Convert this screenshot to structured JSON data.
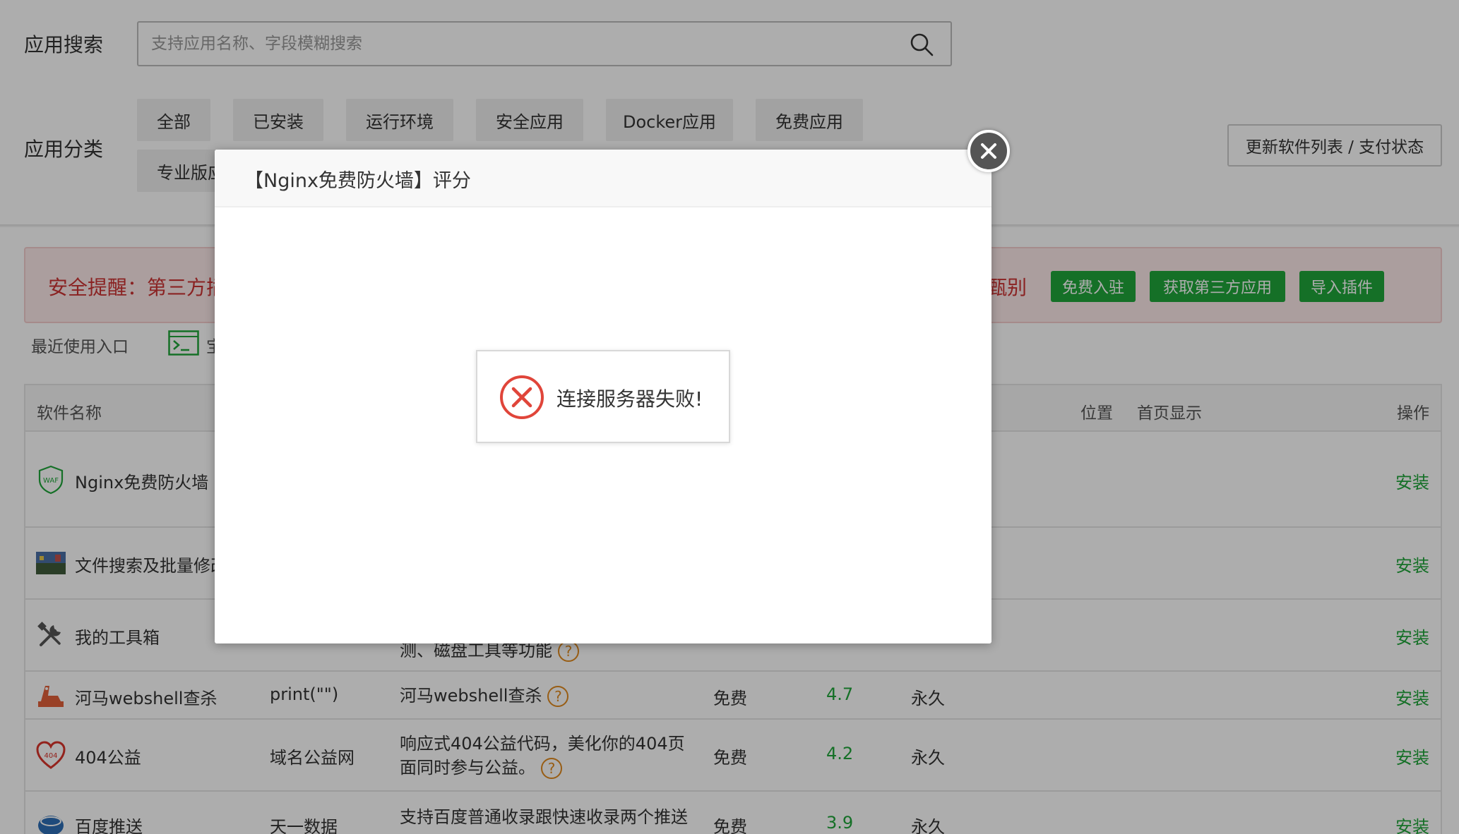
{
  "search": {
    "label": "应用搜索",
    "placeholder": "支持应用名称、字段模糊搜索"
  },
  "category": {
    "label": "应用分类",
    "items": [
      "全部",
      "已安装",
      "运行环境",
      "安全应用",
      "Docker应用",
      "免费应用",
      "专业版应用"
    ]
  },
  "refresh_button": "更新软件列表 / 支付状态",
  "alert": {
    "text": "安全提醒：第三方插",
    "text_tail": "甄别",
    "buttons": [
      "免费入驻",
      "获取第三方应用",
      "导入插件"
    ]
  },
  "recent": {
    "label": "最近使用入口",
    "item": "宝"
  },
  "table": {
    "headers": {
      "name": "软件名称",
      "position": "位置",
      "homepage": "首页显示",
      "action": "操作"
    },
    "rows": [
      {
        "name": "Nginx免费防火墙",
        "developer": "",
        "desc": "",
        "price": "",
        "score": "",
        "expire": "",
        "action": "安装"
      },
      {
        "name": "文件搜索及批量修改",
        "developer": "",
        "desc": "",
        "price": "",
        "score": "",
        "expire": "",
        "action": "安装"
      },
      {
        "name": "我的工具箱",
        "developer": "",
        "desc": "测、磁盘工具等功能",
        "price": "",
        "score": "",
        "expire": "",
        "action": "安装"
      },
      {
        "name": "河马webshell查杀",
        "developer": "print(\"\")",
        "desc": "河马webshell查杀",
        "price": "免费",
        "score": "4.7",
        "expire": "永久",
        "action": "安装"
      },
      {
        "name": "404公益",
        "developer": "域名公益网",
        "desc": "响应式404公益代码，美化你的404页",
        "desc2": "面同时参与公益。",
        "price": "免费",
        "score": "4.2",
        "expire": "永久",
        "action": "安装"
      },
      {
        "name": "百度推送",
        "developer": "天一数据",
        "desc": "支持百度普通收录跟快速收录两个推送",
        "price": "免费",
        "score": "3.9",
        "expire": "永久",
        "action": "安装"
      }
    ],
    "qmark": "?"
  },
  "modal": {
    "title": "【Nginx免费防火墙】评分",
    "message": "连接服务器失败!"
  },
  "colors": {
    "accent": "#20a53a",
    "alert_text": "#cc3333",
    "error_icon": "#e0453a"
  }
}
